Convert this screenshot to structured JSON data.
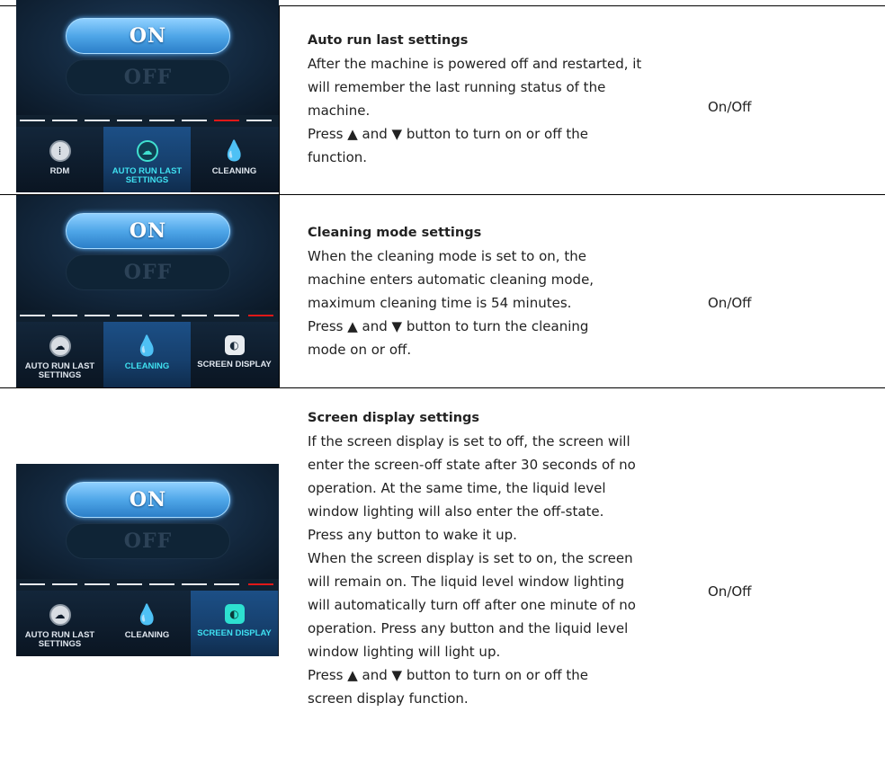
{
  "rows": [
    {
      "screen": {
        "on_label": "ON",
        "off_label": "OFF",
        "tabs": [
          {
            "label": "RDM",
            "icon": "rdm-icon"
          },
          {
            "label": "AUTO RUN LAST SETTINGS",
            "icon": "auto-run-icon"
          },
          {
            "label": "CLEANING",
            "icon": "cleaning-icon"
          }
        ]
      },
      "title": "Auto run last settings",
      "lines": [
        "After the machine is powered off and restarted, it",
        "will remember the last running status of the",
        "machine.",
        "Press ▲ and ▼ button to turn on or off the",
        "function."
      ],
      "value": "On/Off"
    },
    {
      "screen": {
        "on_label": "ON",
        "off_label": "OFF",
        "tabs": [
          {
            "label": "AUTO RUN LAST SETTINGS",
            "icon": "auto-run-icon"
          },
          {
            "label": "CLEANING",
            "icon": "cleaning-icon"
          },
          {
            "label": "SCREEN DISPLAY",
            "icon": "screen-display-icon"
          }
        ]
      },
      "title": "Cleaning mode settings",
      "lines": [
        "When the cleaning mode is set to on, the",
        "machine enters automatic cleaning mode,",
        "maximum cleaning time is 54 minutes.",
        "Press ▲ and ▼ button to turn the cleaning",
        "mode on or off."
      ],
      "value": "On/Off"
    },
    {
      "screen": {
        "on_label": "ON",
        "off_label": "OFF",
        "tabs": [
          {
            "label": "AUTO RUN LAST SETTINGS",
            "icon": "auto-run-icon"
          },
          {
            "label": "CLEANING",
            "icon": "cleaning-icon"
          },
          {
            "label": "SCREEN DISPLAY",
            "icon": "screen-display-icon"
          }
        ]
      },
      "title": "Screen display settings",
      "lines": [
        "If the screen display is set to off, the screen will",
        "enter the screen-off state after 30 seconds of no",
        "operation. At the same time, the liquid level",
        "window lighting will also enter the off-state.",
        "Press any button to wake it up.",
        "When the screen display is set to on, the screen",
        "will remain on. The liquid level window lighting",
        "will automatically turn off after one minute of no",
        "operation. Press any button and the liquid level",
        "window lighting will light up.",
        "Press ▲ and ▼ button to turn on or off the",
        "screen display function."
      ],
      "value": "On/Off"
    }
  ]
}
